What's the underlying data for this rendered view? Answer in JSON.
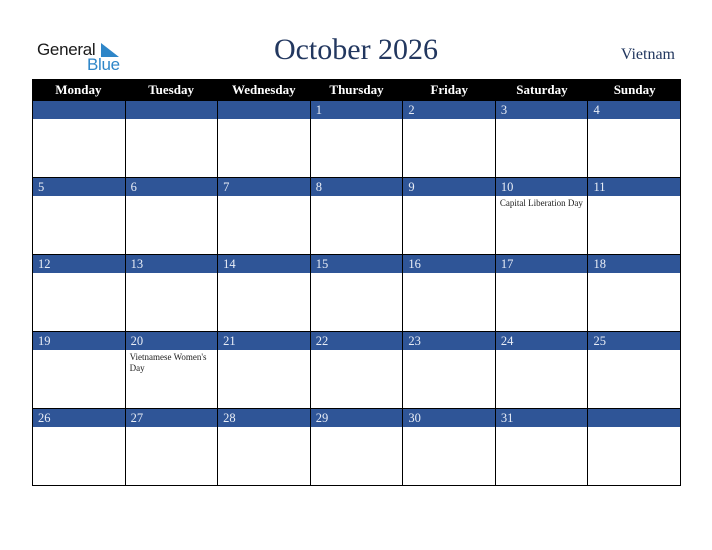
{
  "brand": {
    "line1": "General",
    "line2": "Blue",
    "accent_color": "#2e86c8"
  },
  "header": {
    "title": "October 2026",
    "country": "Vietnam"
  },
  "colors": {
    "header_bg": "#000000",
    "day_bar": "#2f5597",
    "title": "#22375f"
  },
  "weekdays": [
    "Monday",
    "Tuesday",
    "Wednesday",
    "Thursday",
    "Friday",
    "Saturday",
    "Sunday"
  ],
  "weeks": [
    [
      {
        "day": "",
        "event": ""
      },
      {
        "day": "",
        "event": ""
      },
      {
        "day": "",
        "event": ""
      },
      {
        "day": "1",
        "event": ""
      },
      {
        "day": "2",
        "event": ""
      },
      {
        "day": "3",
        "event": ""
      },
      {
        "day": "4",
        "event": ""
      }
    ],
    [
      {
        "day": "5",
        "event": ""
      },
      {
        "day": "6",
        "event": ""
      },
      {
        "day": "7",
        "event": ""
      },
      {
        "day": "8",
        "event": ""
      },
      {
        "day": "9",
        "event": ""
      },
      {
        "day": "10",
        "event": "Capital Liberation Day"
      },
      {
        "day": "11",
        "event": ""
      }
    ],
    [
      {
        "day": "12",
        "event": ""
      },
      {
        "day": "13",
        "event": ""
      },
      {
        "day": "14",
        "event": ""
      },
      {
        "day": "15",
        "event": ""
      },
      {
        "day": "16",
        "event": ""
      },
      {
        "day": "17",
        "event": ""
      },
      {
        "day": "18",
        "event": ""
      }
    ],
    [
      {
        "day": "19",
        "event": ""
      },
      {
        "day": "20",
        "event": "Vietnamese Women's Day"
      },
      {
        "day": "21",
        "event": ""
      },
      {
        "day": "22",
        "event": ""
      },
      {
        "day": "23",
        "event": ""
      },
      {
        "day": "24",
        "event": ""
      },
      {
        "day": "25",
        "event": ""
      }
    ],
    [
      {
        "day": "26",
        "event": ""
      },
      {
        "day": "27",
        "event": ""
      },
      {
        "day": "28",
        "event": ""
      },
      {
        "day": "29",
        "event": ""
      },
      {
        "day": "30",
        "event": ""
      },
      {
        "day": "31",
        "event": ""
      },
      {
        "day": "",
        "event": ""
      }
    ]
  ]
}
